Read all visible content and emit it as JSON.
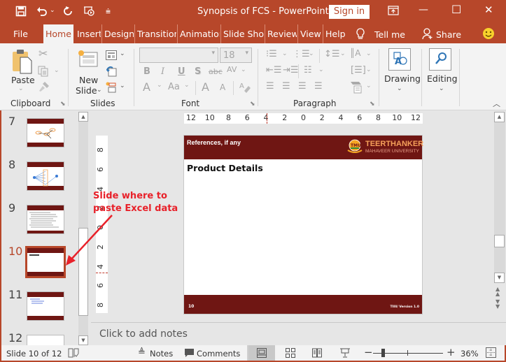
{
  "window": {
    "title": "Synopsis of FCS  -  PowerPoint",
    "sign_in": "Sign in",
    "minimize": "—",
    "maximize": "☐",
    "close": "✕"
  },
  "qat": {
    "save_icon": "save-icon",
    "undo_icon": "undo-icon",
    "redo_icon": "redo-icon",
    "present_icon": "start-from-beginning-icon",
    "customize_icon": "customize-qat-icon"
  },
  "tabs": [
    {
      "label": "File"
    },
    {
      "label": "Home",
      "active": true
    },
    {
      "label": "Insert"
    },
    {
      "label": "Design"
    },
    {
      "label": "Transitions"
    },
    {
      "label": "Animations"
    },
    {
      "label": "Slide Show"
    },
    {
      "label": "Review"
    },
    {
      "label": "View"
    },
    {
      "label": "Help"
    }
  ],
  "tell_me": "Tell me",
  "share": "Share",
  "ribbon": {
    "clipboard": {
      "label": "Clipboard",
      "paste": "Paste"
    },
    "slides": {
      "label": "Slides",
      "new_slide_line1": "New",
      "new_slide_line2": "Slide"
    },
    "font": {
      "label": "Font",
      "font_name": "",
      "font_size": "18",
      "bold": "B",
      "italic": "I",
      "underline": "U",
      "shadow": "S",
      "strike": "abc",
      "spacing": "AV",
      "font_color": "A",
      "change_case": "Aa",
      "grow": "A",
      "shrink": "A"
    },
    "paragraph": {
      "label": "Paragraph"
    },
    "drawing": {
      "label": "Drawing"
    },
    "editing": {
      "label": "Editing"
    }
  },
  "thumbnails": [
    {
      "number": "7"
    },
    {
      "number": "8"
    },
    {
      "number": "9"
    },
    {
      "number": "10",
      "selected": true
    },
    {
      "number": "11"
    },
    {
      "number": "12"
    }
  ],
  "annotation": {
    "line1": "Slide where to",
    "line2": "paste Excel data",
    "color": "#e8212a"
  },
  "rulers": {
    "horizontal": [
      "12",
      "10",
      "8",
      "6",
      "4",
      "2",
      "0",
      "2",
      "4",
      "6",
      "8",
      "10",
      "12"
    ],
    "vertical": [
      "8",
      "6",
      "4",
      "2",
      "0",
      "2",
      "4",
      "6",
      "8"
    ]
  },
  "slide": {
    "header_title": "References, if any",
    "logo_badge": "TMU",
    "logo_line1": "TEERTHANKER",
    "logo_line2": "MAHAVEER UNIVERSITY",
    "body_title": "Product Details",
    "footer_number": "10",
    "footer_version": "TIIII/ Version 1.0",
    "theme_color": "#6f1613"
  },
  "notes": {
    "placeholder": "Click to add notes"
  },
  "status": {
    "slide_indicator": "Slide 10 of 12",
    "notes": "Notes",
    "comments": "Comments",
    "zoom_percent": "36%",
    "zoom_level": 0.36
  }
}
